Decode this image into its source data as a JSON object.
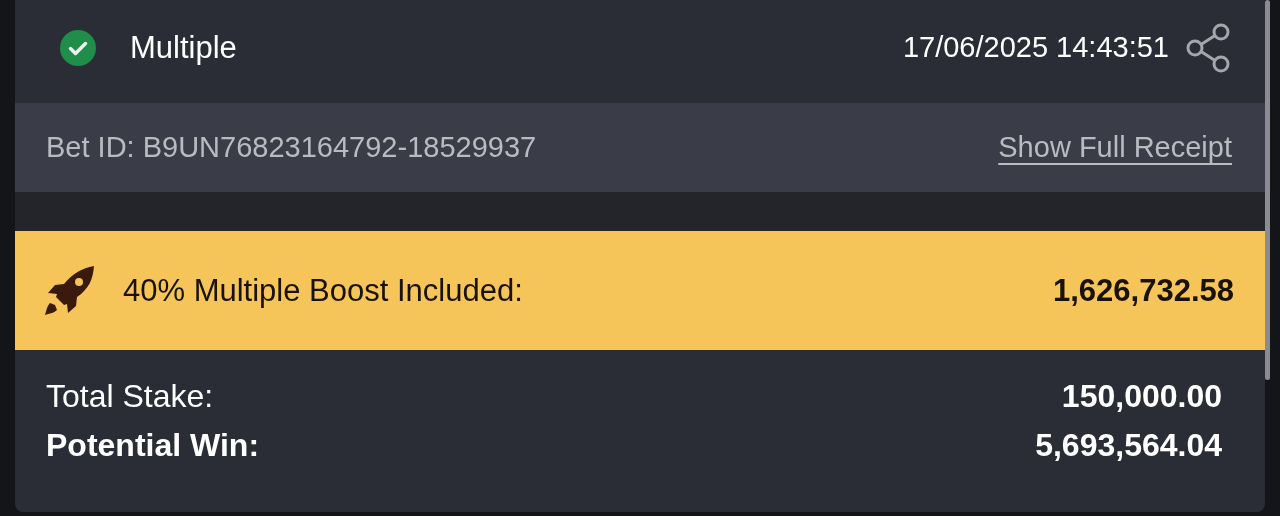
{
  "header": {
    "won": true,
    "title": "Multiple",
    "timestamp": "17/06/2025 14:43:51"
  },
  "bet_info": {
    "bet_id": "Bet ID: B9UN76823164792-18529937",
    "link": "Show Full Receipt"
  },
  "boost": {
    "label": "40% Multiple Boost Included:",
    "amount": "1,626,732.58"
  },
  "totals": [
    {
      "label": "Total Stake:",
      "value": "150,000.00",
      "bold": false
    },
    {
      "label": "Potential Win:",
      "value": "5,693,564.04",
      "bold": true
    }
  ]
}
